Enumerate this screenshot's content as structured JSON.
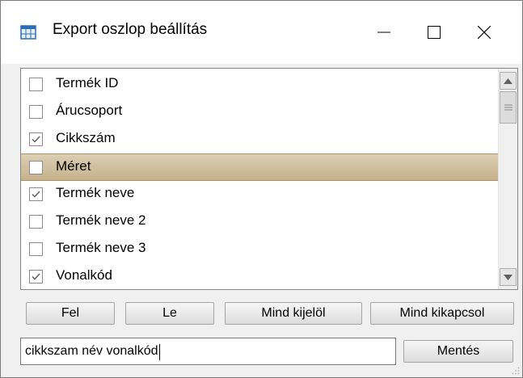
{
  "window": {
    "title": "Export oszlop beállítás",
    "controls": {
      "minimize": "—",
      "maximize": "☐",
      "close": "✕"
    }
  },
  "columns": [
    {
      "label": "Termék ID",
      "checked": false,
      "selected": false
    },
    {
      "label": "Árucsoport",
      "checked": false,
      "selected": false
    },
    {
      "label": "Cikkszám",
      "checked": true,
      "selected": false
    },
    {
      "label": "Méret",
      "checked": false,
      "selected": true
    },
    {
      "label": "Termék neve",
      "checked": true,
      "selected": false
    },
    {
      "label": "Termék neve 2",
      "checked": false,
      "selected": false
    },
    {
      "label": "Termék neve 3",
      "checked": false,
      "selected": false
    },
    {
      "label": "Vonalkód",
      "checked": true,
      "selected": false
    }
  ],
  "buttons": {
    "up": "Fel",
    "down": "Le",
    "select_all": "Mind kijelöl",
    "deselect_all": "Mind kikapcsol",
    "save": "Mentés"
  },
  "search": {
    "value": "cikkszam név vonalkód"
  },
  "icons": {
    "app": "table-export-icon",
    "scroll_up": "arrow-up-icon",
    "scroll_down": "arrow-down-icon",
    "grip": "resize-grip-icon"
  },
  "colors": {
    "selected_row": "#cdbb97",
    "checkmark": "#5a5a5a"
  }
}
